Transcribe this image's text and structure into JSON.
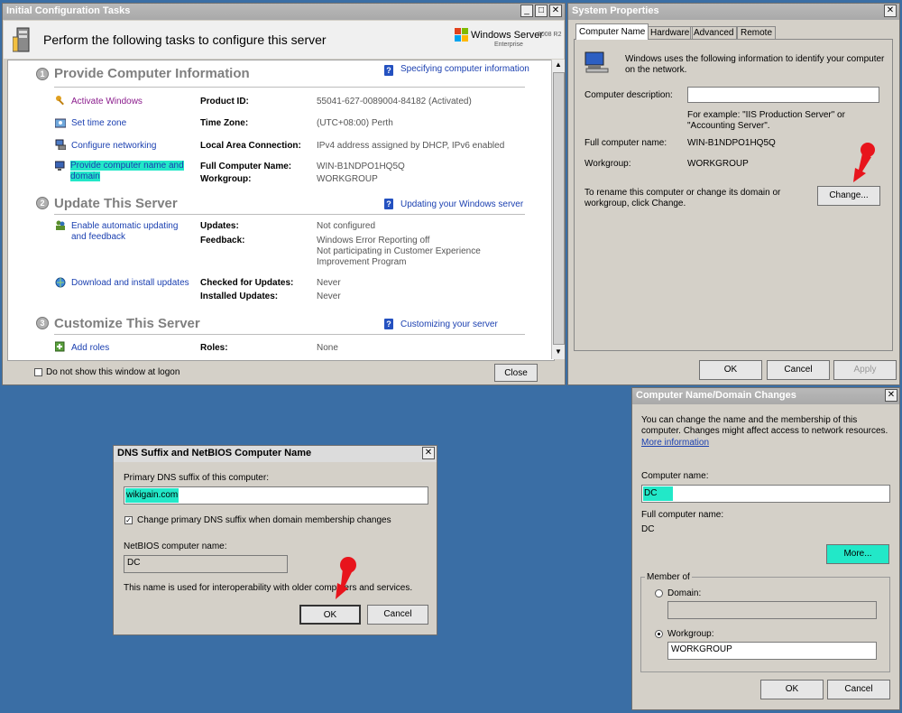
{
  "ict": {
    "title": "Initial Configuration Tasks",
    "header": "Perform the following tasks to configure this server",
    "logo": {
      "brand": "Windows Server",
      "version": "2008 R2",
      "edition": "Enterprise"
    },
    "section1": {
      "num": "1",
      "title": "Provide Computer Information",
      "help": "Specifying computer information",
      "tasks": {
        "activate": "Activate Windows",
        "timezone": "Set time zone",
        "networking": "Configure networking",
        "name": "Provide computer name and domain"
      },
      "labels": {
        "product_id": "Product ID:",
        "time_zone": "Time Zone:",
        "lan": "Local Area Connection:",
        "full_name": "Full Computer Name:",
        "workgroup": "Workgroup:"
      },
      "values": {
        "product_id": "55041-627-0089004-84182 (Activated)",
        "time_zone": "(UTC+08:00) Perth",
        "lan": "IPv4 address assigned by DHCP, IPv6 enabled",
        "full_name": "WIN-B1NDPO1HQ5Q",
        "workgroup": "WORKGROUP"
      }
    },
    "section2": {
      "num": "2",
      "title": "Update This Server",
      "help": "Updating your Windows server",
      "tasks": {
        "auto_update": "Enable automatic updating and feedback",
        "download": "Download and install updates"
      },
      "labels": {
        "updates": "Updates:",
        "feedback": "Feedback:",
        "checked": "Checked for Updates:",
        "installed": "Installed Updates:"
      },
      "values": {
        "updates": "Not configured",
        "feedback1": "Windows Error Reporting off",
        "feedback2": "Not participating in Customer Experience",
        "feedback3": "Improvement Program",
        "checked": "Never",
        "installed": "Never"
      }
    },
    "section3": {
      "num": "3",
      "title": "Customize This Server",
      "help": "Customizing your server",
      "tasks": {
        "add_roles": "Add roles"
      },
      "labels": {
        "roles": "Roles:"
      },
      "values": {
        "roles": "None"
      }
    },
    "footer": {
      "checkbox": "Do not show this window at logon",
      "close": "Close"
    }
  },
  "sysprops": {
    "title": "System Properties",
    "tabs": [
      "Computer Name",
      "Hardware",
      "Advanced",
      "Remote"
    ],
    "intro": "Windows uses the following information to identify your computer on the network.",
    "desc_label": "Computer description:",
    "example": "For example: \"IIS Production Server\" or \"Accounting Server\".",
    "full_label": "Full computer name:",
    "full_value": "WIN-B1NDPO1HQ5Q",
    "wg_label": "Workgroup:",
    "wg_value": "WORKGROUP",
    "rename_text": "To rename this computer or change its domain or workgroup, click Change.",
    "change": "Change...",
    "ok": "OK",
    "cancel": "Cancel",
    "apply": "Apply"
  },
  "cndc": {
    "title": "Computer Name/Domain Changes",
    "intro": "You can change the name and the membership of this computer. Changes might affect access to network resources.",
    "more_info": "More information",
    "name_label": "Computer name:",
    "name_value": "DC",
    "full_label": "Full computer name:",
    "full_value": "DC",
    "more": "More...",
    "member_of": "Member of",
    "domain": "Domain:",
    "workgroup": "Workgroup:",
    "workgroup_value": "WORKGROUP",
    "ok": "OK",
    "cancel": "Cancel"
  },
  "dns": {
    "title": "DNS Suffix and NetBIOS Computer Name",
    "suffix_label": "Primary DNS suffix of this computer:",
    "suffix_value": "wikigain.com",
    "checkbox": "Change primary DNS suffix when domain membership changes",
    "netbios_label": "NetBIOS computer name:",
    "netbios_value": "DC",
    "note": "This name is used for interoperability with older computers and services.",
    "ok": "OK",
    "cancel": "Cancel"
  },
  "colors": {
    "highlight": "#22e8c8",
    "desktop": "#3a6ea5",
    "link": "#1a3fb0",
    "pointer": "#e8141c"
  }
}
